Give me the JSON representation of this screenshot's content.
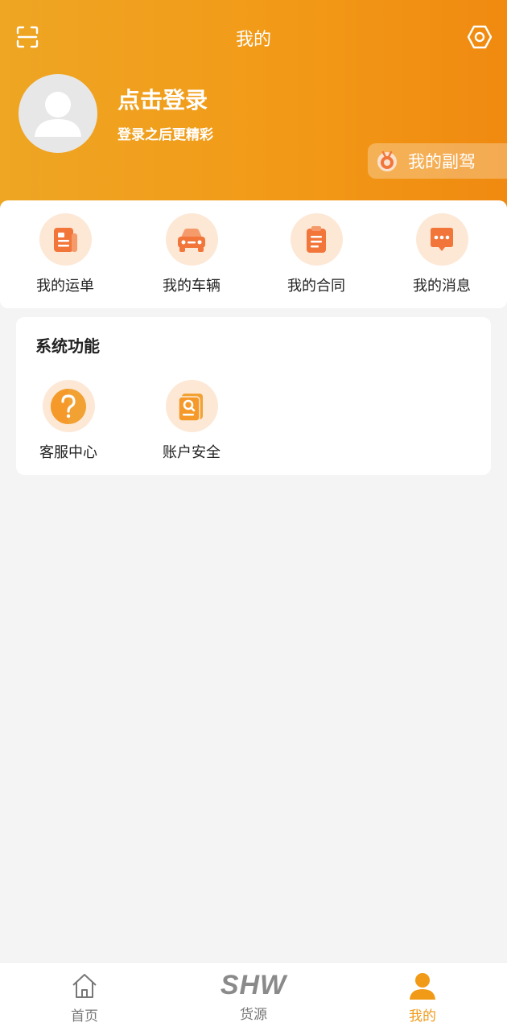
{
  "header": {
    "title": "我的",
    "login_title": "点击登录",
    "login_subtitle": "登录之后更精彩",
    "copilot_label": "我的副驾"
  },
  "quick_actions": [
    {
      "label": "我的运单",
      "icon": "waybill-icon"
    },
    {
      "label": "我的车辆",
      "icon": "car-icon"
    },
    {
      "label": "我的合同",
      "icon": "contract-icon"
    },
    {
      "label": "我的消息",
      "icon": "message-icon"
    }
  ],
  "system": {
    "title": "系统功能",
    "items": [
      {
        "label": "客服中心",
        "icon": "help-icon"
      },
      {
        "label": "账户安全",
        "icon": "account-security-icon"
      }
    ]
  },
  "tabbar": {
    "items": [
      {
        "label": "首页",
        "icon": "home-icon"
      },
      {
        "label": "货源",
        "icon": "shw-logo-icon",
        "logo_text": "SHW"
      },
      {
        "label": "我的",
        "icon": "user-icon",
        "active": true
      }
    ]
  },
  "colors": {
    "accent": "#f09a17",
    "header_start": "#eea623",
    "header_end": "#f08a10",
    "icon_orange": "#f2763a",
    "icon_bg": "#fde8d6"
  }
}
